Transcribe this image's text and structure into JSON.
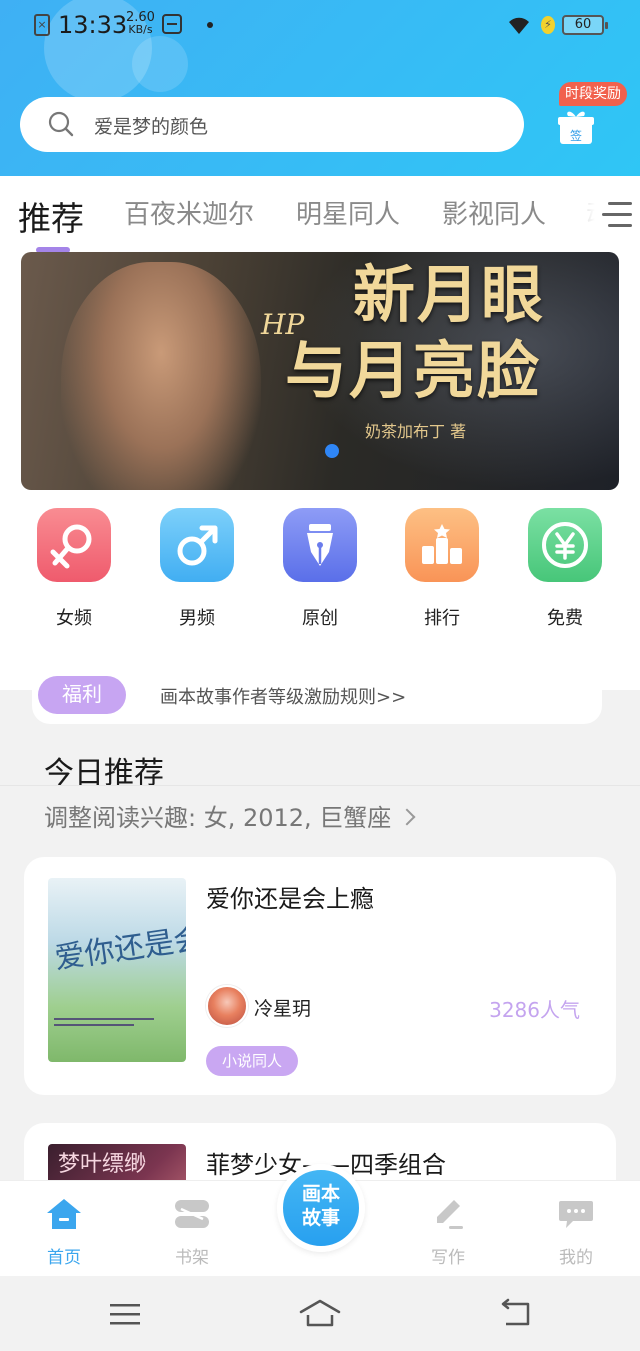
{
  "status_bar": {
    "time": "13:33",
    "speed_value": "2.60",
    "speed_unit": "KB/s",
    "battery": "60"
  },
  "search": {
    "placeholder": "爱是梦的颜色"
  },
  "reward_badge": "时段奖励",
  "gift_label": "签",
  "tabs": [
    {
      "label": "推荐",
      "active": true
    },
    {
      "label": "百夜米迦尔",
      "active": false
    },
    {
      "label": "明星同人",
      "active": false
    },
    {
      "label": "影视同人",
      "active": false
    },
    {
      "label": "动",
      "active": false
    }
  ],
  "banner": {
    "hp": "HP",
    "title_line1": "新月眼",
    "title_line2": "与月亮脸",
    "author": "奶茶加布丁 著"
  },
  "categories": [
    {
      "label": "女频",
      "icon": "female-icon",
      "color": "#f36b78"
    },
    {
      "label": "男频",
      "icon": "male-icon",
      "color": "#4fb8f3"
    },
    {
      "label": "原创",
      "icon": "pen-nib-icon",
      "color": "#6c80f0"
    },
    {
      "label": "排行",
      "icon": "ranking-icon",
      "color": "#fba86a"
    },
    {
      "label": "免费",
      "icon": "yuan-icon",
      "color": "#5fd38a"
    }
  ],
  "welfare": {
    "badge": "福利",
    "text": "画本故事作者等级激励规则>>"
  },
  "section": {
    "title": "今日推荐",
    "interest": "调整阅读兴趣: 女, 2012, 巨蟹座"
  },
  "books": [
    {
      "title": "爱你还是会上瘾",
      "cover_text": "爱你还是会上瘾",
      "author": "冷星玥",
      "popularity": "3286人气",
      "tag": "小说同人"
    },
    {
      "title": "菲梦少女——四季组合",
      "cover_text": "梦叶缥缈"
    }
  ],
  "bottom_nav": [
    {
      "label": "首页",
      "icon": "home-icon",
      "active": true
    },
    {
      "label": "书架",
      "icon": "bookshelf-icon",
      "active": false
    },
    {
      "label": "写作",
      "icon": "pencil-icon",
      "active": false
    },
    {
      "label": "我的",
      "icon": "chat-bubble-icon",
      "active": false
    }
  ],
  "center_button": {
    "line1": "画本",
    "line2": "故事"
  },
  "colors": {
    "accent_blue": "#3ba6ee",
    "accent_purple": "#c7a5f2"
  }
}
